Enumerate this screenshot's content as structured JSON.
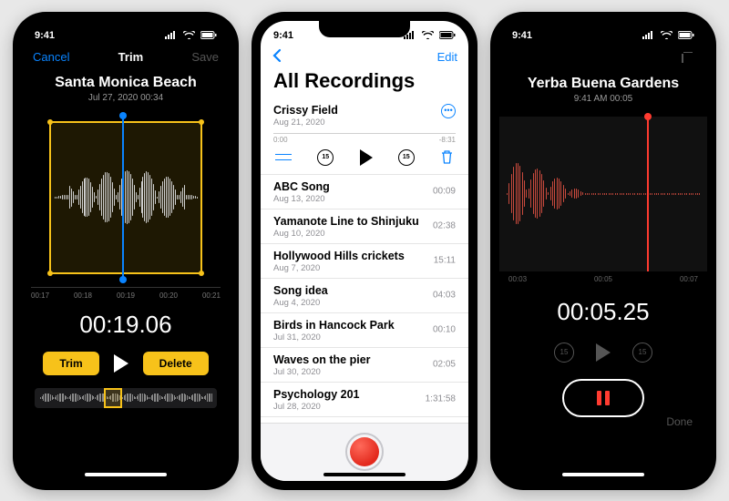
{
  "status": {
    "time": "9:41"
  },
  "phone1": {
    "nav": {
      "left": "Cancel",
      "center": "Trim",
      "right": "Save"
    },
    "title": "Santa Monica Beach",
    "subtitle": "Jul 27, 2020   00:34",
    "ticks": [
      "00:17",
      "00:18",
      "00:19",
      "00:20",
      "00:21"
    ],
    "timecode": "00:19.06",
    "trim_label": "Trim",
    "delete_label": "Delete"
  },
  "phone2": {
    "nav": {
      "edit": "Edit"
    },
    "heading": "All Recordings",
    "expanded": {
      "name": "Crissy Field",
      "date": "Aug 21, 2020",
      "pos": "0:00",
      "neg": "-8:31",
      "skip": "15"
    },
    "items": [
      {
        "name": "ABC Song",
        "date": "Aug 13, 2020",
        "dur": "00:09"
      },
      {
        "name": "Yamanote Line to Shinjuku",
        "date": "Aug 10, 2020",
        "dur": "02:38"
      },
      {
        "name": "Hollywood Hills crickets",
        "date": "Aug 7, 2020",
        "dur": "15:11"
      },
      {
        "name": "Song idea",
        "date": "Aug 4, 2020",
        "dur": "04:03"
      },
      {
        "name": "Birds in Hancock Park",
        "date": "Jul 31, 2020",
        "dur": "00:10"
      },
      {
        "name": "Waves on the pier",
        "date": "Jul 30, 2020",
        "dur": "02:05"
      },
      {
        "name": "Psychology 201",
        "date": "Jul 28, 2020",
        "dur": "1:31:58"
      }
    ]
  },
  "phone3": {
    "title": "Yerba Buena Gardens",
    "subtitle": "9:41 AM   00:05",
    "ticks": [
      "00:03",
      "00:05",
      "00:07"
    ],
    "timecode": "00:05.25",
    "skip": "15",
    "done": "Done"
  }
}
